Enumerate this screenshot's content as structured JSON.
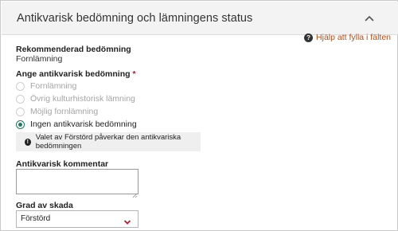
{
  "panel": {
    "title": "Antikvarisk bedömning och lämningens status",
    "collapse_icon": "chevron-up-icon"
  },
  "help": {
    "label": "Hjälp att fylla i fälten",
    "icon": "question-circle-icon",
    "color": "#c24a0e"
  },
  "recommended": {
    "label": "Rekommenderad bedömning",
    "value": "Fornlämning"
  },
  "assessment": {
    "label": "Ange antikvarisk bedömning",
    "required_marker": "*",
    "options": [
      {
        "label": "Fornlämning",
        "selected": false,
        "disabled": true
      },
      {
        "label": "Övrig kulturhistorisk lämning",
        "selected": false,
        "disabled": true
      },
      {
        "label": "Möjlig fornlämning",
        "selected": false,
        "disabled": true
      },
      {
        "label": "Ingen antikvarisk bedömning",
        "selected": true,
        "disabled": false
      }
    ],
    "accent_color": "#1d7a5a"
  },
  "info": {
    "icon": "info-circle-icon",
    "text": "Valet av Förstörd påverkar den antikvariska bedömningen"
  },
  "comment": {
    "label": "Antikvarisk kommentar",
    "value": ""
  },
  "damage": {
    "label": "Grad av skada",
    "selected": "Förstörd",
    "chevron_color": "#c8102e"
  }
}
